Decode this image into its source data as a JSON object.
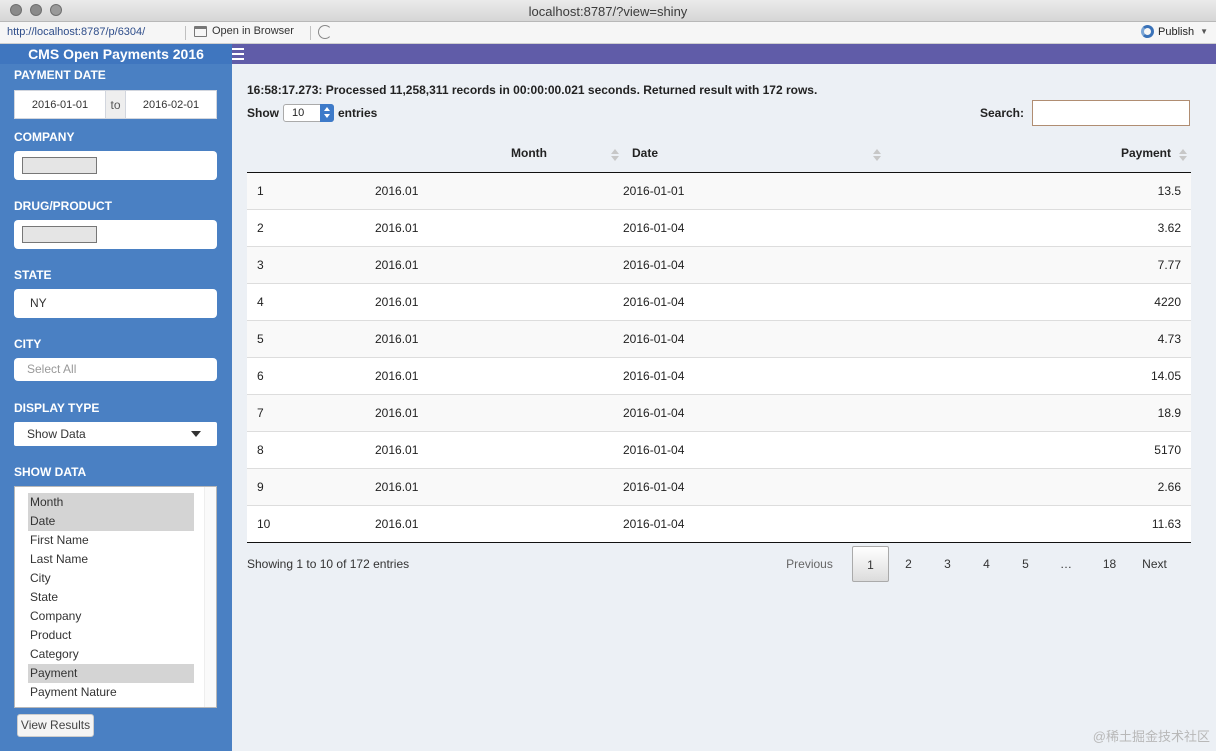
{
  "window": {
    "title": "localhost:8787/?view=shiny"
  },
  "toolbar": {
    "url": "http://localhost:8787/p/6304/",
    "open_browser_label": "Open in Browser",
    "publish_label": "Publish"
  },
  "app": {
    "title": "CMS Open Payments 2016"
  },
  "sidebar": {
    "payment_date_label": "PAYMENT DATE",
    "date_start": "2016-01-01",
    "date_to": "to",
    "date_end": "2016-02-01",
    "company_label": "COMPANY",
    "drug_label": "DRUG/PRODUCT",
    "state_label": "STATE",
    "state_value": "NY",
    "city_label": "CITY",
    "city_placeholder": "Select All",
    "display_type_label": "DISPLAY TYPE",
    "display_type_value": "Show Data",
    "show_data_label": "SHOW DATA",
    "show_data_options": [
      {
        "label": "Month",
        "selected": true
      },
      {
        "label": "Date",
        "selected": true
      },
      {
        "label": "First Name",
        "selected": false
      },
      {
        "label": "Last Name",
        "selected": false
      },
      {
        "label": "City",
        "selected": false
      },
      {
        "label": "State",
        "selected": false
      },
      {
        "label": "Company",
        "selected": false
      },
      {
        "label": "Product",
        "selected": false
      },
      {
        "label": "Category",
        "selected": false
      },
      {
        "label": "Payment",
        "selected": true
      },
      {
        "label": "Payment Nature",
        "selected": false
      }
    ],
    "view_results_label": "View Results"
  },
  "main": {
    "status": "16:58:17.273: Processed 11,258,311 records in 00:00:00.021 seconds. Returned result with 172 rows.",
    "show_label": "Show",
    "entries_value": "10",
    "entries_label": "entries",
    "search_label": "Search:",
    "search_value": "",
    "columns": [
      "Month",
      "Date",
      "Payment"
    ],
    "rows": [
      [
        "1",
        "2016.01",
        "2016-01-01",
        "13.5"
      ],
      [
        "2",
        "2016.01",
        "2016-01-04",
        "3.62"
      ],
      [
        "3",
        "2016.01",
        "2016-01-04",
        "7.77"
      ],
      [
        "4",
        "2016.01",
        "2016-01-04",
        "4220"
      ],
      [
        "5",
        "2016.01",
        "2016-01-04",
        "4.73"
      ],
      [
        "6",
        "2016.01",
        "2016-01-04",
        "14.05"
      ],
      [
        "7",
        "2016.01",
        "2016-01-04",
        "18.9"
      ],
      [
        "8",
        "2016.01",
        "2016-01-04",
        "5170"
      ],
      [
        "9",
        "2016.01",
        "2016-01-04",
        "2.66"
      ],
      [
        "10",
        "2016.01",
        "2016-01-04",
        "11.63"
      ]
    ],
    "info": "Showing 1 to 10 of 172 entries",
    "pagination": {
      "previous": "Previous",
      "pages": [
        "1",
        "2",
        "3",
        "4",
        "5",
        "…",
        "18"
      ],
      "active_page": "1",
      "next": "Next"
    }
  },
  "watermark": "@稀土掘金技术社区",
  "colors": {
    "sidebar": "#4a80c3",
    "header": "#605ca8",
    "pagination_active_border": "#aaaaaa"
  }
}
